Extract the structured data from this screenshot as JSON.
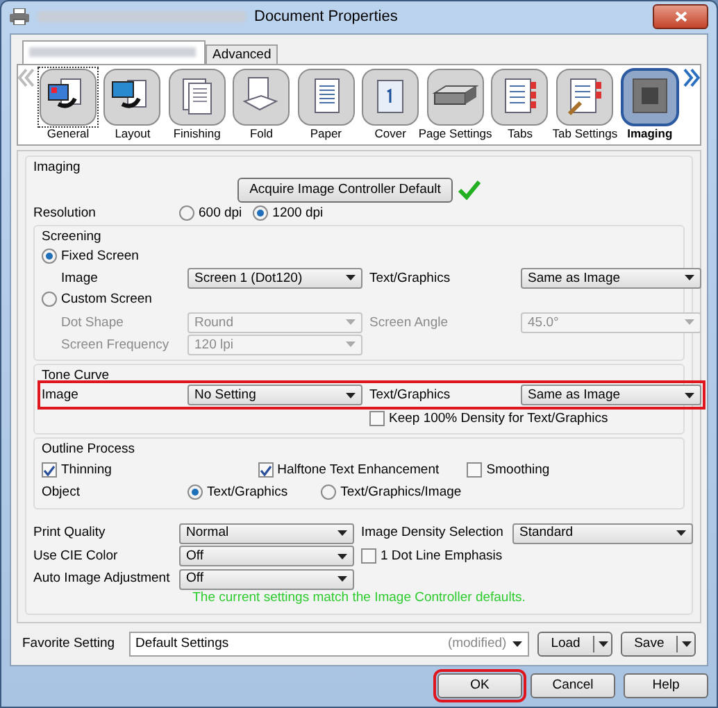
{
  "window": {
    "title": "Document Properties"
  },
  "tabs": [
    {
      "kind": "blurred",
      "selected": true
    },
    {
      "kind": "text",
      "label": "Advanced",
      "selected": false
    }
  ],
  "categories": [
    {
      "label": "General",
      "selected": false,
      "focused": true
    },
    {
      "label": "Layout",
      "selected": false,
      "focused": false
    },
    {
      "label": "Finishing",
      "selected": false,
      "focused": false
    },
    {
      "label": "Fold",
      "selected": false,
      "focused": false
    },
    {
      "label": "Paper",
      "selected": false,
      "focused": false
    },
    {
      "label": "Cover",
      "selected": false,
      "focused": false
    },
    {
      "label": "Page Settings",
      "selected": false,
      "focused": false
    },
    {
      "label": "Tabs",
      "selected": false,
      "focused": false
    },
    {
      "label": "Tab Settings",
      "selected": false,
      "focused": false
    },
    {
      "label": "Imaging",
      "selected": true,
      "focused": false
    }
  ],
  "imaging": {
    "title": "Imaging",
    "acquire_button": "Acquire Image Controller Default",
    "resolution_label": "Resolution",
    "resolution_options": [
      {
        "label": "600 dpi",
        "selected": false
      },
      {
        "label": "1200 dpi",
        "selected": true
      }
    ]
  },
  "screening": {
    "title": "Screening",
    "modes": [
      {
        "label": "Fixed Screen",
        "selected": true,
        "fields": [
          {
            "label": "Image",
            "value": "Screen 1 (Dot120)",
            "disabled": false
          },
          {
            "label": "Text/Graphics",
            "value": "Same as Image",
            "disabled": false
          }
        ]
      },
      {
        "label": "Custom Screen",
        "selected": false,
        "fields": [
          {
            "label": "Dot Shape",
            "value": "Round",
            "disabled": true
          },
          {
            "label": "Screen Angle",
            "value": "45.0°",
            "disabled": true
          },
          {
            "label": "Screen Frequency",
            "value": "120 lpi",
            "disabled": true
          }
        ]
      }
    ]
  },
  "tone_curve": {
    "title": "Tone Curve",
    "highlighted": true,
    "fields": [
      {
        "label": "Image",
        "value": "No Setting"
      },
      {
        "label": "Text/Graphics",
        "value": "Same as Image"
      }
    ],
    "keep_density": {
      "label": "Keep 100% Density for Text/Graphics",
      "checked": false
    }
  },
  "outline_process": {
    "title": "Outline Process",
    "checks": [
      {
        "label": "Thinning",
        "checked": true
      },
      {
        "label": "Halftone Text Enhancement",
        "checked": true
      },
      {
        "label": "Smoothing",
        "checked": false
      }
    ],
    "object_label": "Object",
    "object_options": [
      {
        "label": "Text/Graphics",
        "selected": true
      },
      {
        "label": "Text/Graphics/Image",
        "selected": false
      }
    ]
  },
  "quality": {
    "fields": [
      {
        "kind": "select",
        "label": "Print Quality",
        "value": "Normal"
      },
      {
        "kind": "select",
        "label": "Image Density Selection",
        "value": "Standard"
      },
      {
        "kind": "select",
        "label": "Use CIE Color",
        "value": "Off"
      },
      {
        "kind": "checkbox",
        "label": "1 Dot Line Emphasis",
        "checked": false
      },
      {
        "kind": "select",
        "label": "Auto Image Adjustment",
        "value": "Off"
      }
    ]
  },
  "status_message": "The current settings match the Image Controller defaults.",
  "favorite": {
    "label": "Favorite Setting",
    "value": "Default Settings",
    "note": "(modified)",
    "buttons": [
      "Load",
      "Save"
    ]
  },
  "buttons": [
    {
      "label": "OK",
      "highlighted": true
    },
    {
      "label": "Cancel",
      "highlighted": false
    },
    {
      "label": "Help",
      "highlighted": false
    }
  ]
}
